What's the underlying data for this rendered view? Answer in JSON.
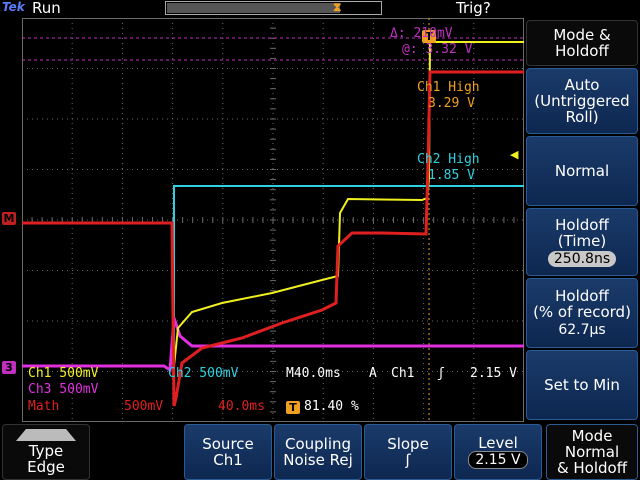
{
  "status": {
    "brand": "Tek",
    "run_state": "Run",
    "trigger_state": "Trig?"
  },
  "cursor_readout": {
    "delta": "Δ: 210mV",
    "at": "@: 3.32 V"
  },
  "annotations": {
    "ch1_high_label": "Ch1 High",
    "ch1_high_value": "3.29 V",
    "ch2_high_label": "Ch2 High",
    "ch2_high_value": "1.85 V"
  },
  "markers": {
    "math": "M",
    "ch3": "3",
    "trigger": "T"
  },
  "readouts": {
    "row1_ch1": "Ch1  500mV",
    "row1_ch2": "Ch2  500mV",
    "timebase": "M40.0ms",
    "trig_mode": "A",
    "trig_src": "Ch1",
    "trig_slope_symbol": "ʃ",
    "trig_level": "2.15 V",
    "row2_ch3": "Ch3  500mV",
    "row3_math_label": "Math",
    "row3_math_scale": "500mV",
    "row3_math_time": "40.0ms",
    "row3_trig_pos": "81.40 %"
  },
  "side_menu": {
    "title_line1": "Mode &",
    "title_line2": "Holdoff",
    "auto_line1": "Auto",
    "auto_line2": "(Untriggered",
    "auto_line3": "Roll)",
    "normal": "Normal",
    "holdoff_time_line1": "Holdoff",
    "holdoff_time_line2": "(Time)",
    "holdoff_time_value": "250.8ns",
    "holdoff_pct_line1": "Holdoff",
    "holdoff_pct_line2": "(% of record)",
    "holdoff_pct_value": "62.7µs",
    "set_to_min": "Set to Min"
  },
  "bottom_menu": {
    "type_label": "Type",
    "type_value": "Edge",
    "source_label": "Source",
    "source_value": "Ch1",
    "coupling_label": "Coupling",
    "coupling_value": "Noise Rej",
    "slope_label": "Slope",
    "slope_value": "ʃ",
    "level_label": "Level",
    "level_value": "2.15 V",
    "mode_line1": "Mode",
    "mode_line2": "Normal",
    "mode_line3": "& Holdoff"
  },
  "colors": {
    "ch1": "#f0f020",
    "ch2": "#30d0e0",
    "ch3": "#e030e0",
    "math": "#e02020",
    "trigger": "#f0a020",
    "grid": "#6a6a6a",
    "accent": "#1b3b6a"
  },
  "record_position_fraction": 0.81
}
